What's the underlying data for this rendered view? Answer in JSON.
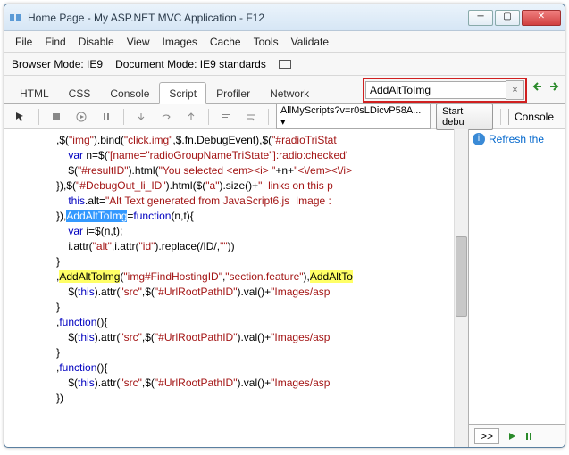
{
  "window": {
    "title": "Home Page - My ASP.NET MVC Application - F12"
  },
  "menu": {
    "file": "File",
    "find": "Find",
    "disable": "Disable",
    "view": "View",
    "images": "Images",
    "cache": "Cache",
    "tools": "Tools",
    "validate": "Validate"
  },
  "mode": {
    "browser_label": "Browser Mode:",
    "browser_value": "IE9",
    "doc_label": "Document Mode:",
    "doc_value": "IE9 standards"
  },
  "tabs": {
    "html": "HTML",
    "css": "CSS",
    "console": "Console",
    "script": "Script",
    "profiler": "Profiler",
    "network": "Network"
  },
  "search": {
    "value": "AddAltToImg",
    "clear": "×"
  },
  "toolbar": {
    "script_combo": "AllMyScripts?v=r0sLDicvP58A...",
    "start": "Start debu",
    "console_tab": "Console"
  },
  "right": {
    "refresh": "Refresh the"
  },
  "bottom": {
    "prompt": ">>"
  },
  "code": {
    "l1a": ",$(",
    "l1b": "\"img\"",
    "l1c": ").bind(",
    "l1d": "\"click.img\"",
    "l1e": ",$.fn.DebugEvent),$(",
    "l1f": "\"#radioTriStat",
    "l2a": "    var",
    "l2b": " n=$(",
    "l2c": "'[name=\"radioGroupNameTriState\"]:radio:checked'",
    "l3a": "    $(",
    "l3b": "\"#resultID\"",
    "l3c": ").html(",
    "l3d": "\"You selected <em><i> \"",
    "l3e": "+n+",
    "l3f": "\"<\\/em><\\/i>",
    "l4a": "}),$(",
    "l4b": "\"#DebugOut_li_ID\"",
    "l4c": ").html($(",
    "l4d": "\"a\"",
    "l4e": ").size()+",
    "l4f": "\"  links on this p",
    "l5a": "    this",
    "l5b": ".alt=",
    "l5c": "\"Alt Text generated from JavaScript6.js  Image :",
    "l6a": "}),",
    "l6b": "AddAltToImg",
    "l6c": "=",
    "l6d": "function",
    "l6e": "(n,t){",
    "l7a": "    var",
    "l7b": " i=$(n,t);",
    "l8a": "    i.attr(",
    "l8b": "\"alt\"",
    "l8c": ",i.attr(",
    "l8d": "\"id\"",
    "l8e": ").replace(/ID/,",
    "l8f": "\"\"",
    "l8g": "))",
    "l9": "}",
    "l10a": ",",
    "l10b": "AddAltToImg",
    "l10c": "(",
    "l10d": "\"img#FindHostingID\"",
    "l10e": ",",
    "l10f": "\"section.feature\"",
    "l10g": "),",
    "l10h": "AddAltTo",
    "l11a": "    $(",
    "l11b": "this",
    "l11c": ").attr(",
    "l11d": "\"src\"",
    "l11e": ",$(",
    "l11f": "\"#UrlRootPathID\"",
    "l11g": ").val()+",
    "l11h": "\"Images/asp",
    "l12": "}",
    "l13a": ",",
    "l13b": "function",
    "l13c": "(){",
    "l14a": "    $(",
    "l14b": "this",
    "l14c": ").attr(",
    "l14d": "\"src\"",
    "l14e": ",$(",
    "l14f": "\"#UrlRootPathID\"",
    "l14g": ").val()+",
    "l14h": "\"Images/asp",
    "l15": "}",
    "l16a": ",",
    "l16b": "function",
    "l16c": "(){",
    "l17a": "    $(",
    "l17b": "this",
    "l17c": ").attr(",
    "l17d": "\"src\"",
    "l17e": ",$(",
    "l17f": "\"#UrlRootPathID\"",
    "l17g": ").val()+",
    "l17h": "\"Images/asp",
    "l18": "})"
  }
}
